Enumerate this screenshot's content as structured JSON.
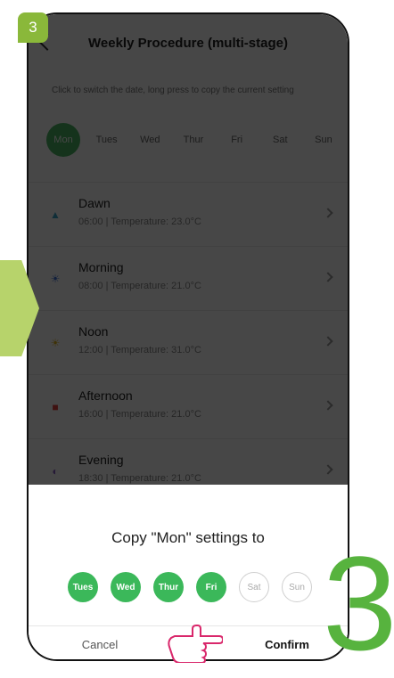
{
  "step_badge": "3",
  "big_step_number": "3",
  "accent_color": "#4cb865",
  "header": {
    "title": "Weekly Procedure (multi-stage)"
  },
  "hint": "Click to switch the date, long press to copy the current setting",
  "days": [
    {
      "label": "Mon",
      "active": true
    },
    {
      "label": "Tues",
      "active": false
    },
    {
      "label": "Wed",
      "active": false
    },
    {
      "label": "Thur",
      "active": false
    },
    {
      "label": "Fri",
      "active": false
    },
    {
      "label": "Sat",
      "active": false
    },
    {
      "label": "Sun",
      "active": false
    }
  ],
  "periods": [
    {
      "name": "Dawn",
      "detail": "06:00 | Temperature: 23.0°C",
      "icon": "dawn-icon",
      "color": "#3aa6c8"
    },
    {
      "name": "Morning",
      "detail": "08:00 | Temperature: 21.0°C",
      "icon": "morning-icon",
      "color": "#3e6fd8"
    },
    {
      "name": "Noon",
      "detail": "12:00 | Temperature: 31.0°C",
      "icon": "noon-icon",
      "color": "#e3b21b"
    },
    {
      "name": "Afternoon",
      "detail": "16:00 | Temperature: 21.0°C",
      "icon": "afternoon-icon",
      "color": "#e0423f"
    },
    {
      "name": "Evening",
      "detail": "18:30 | Temperature: 21.0°C",
      "icon": "evening-icon",
      "color": "#8a5fc4"
    }
  ],
  "sheet": {
    "title": "Copy \"Mon\" settings to",
    "days": [
      {
        "label": "Tues",
        "selected": true
      },
      {
        "label": "Wed",
        "selected": true
      },
      {
        "label": "Thur",
        "selected": true
      },
      {
        "label": "Fri",
        "selected": true
      },
      {
        "label": "Sat",
        "selected": false
      },
      {
        "label": "Sun",
        "selected": false
      }
    ],
    "cancel_label": "Cancel",
    "confirm_label": "Confirm"
  }
}
